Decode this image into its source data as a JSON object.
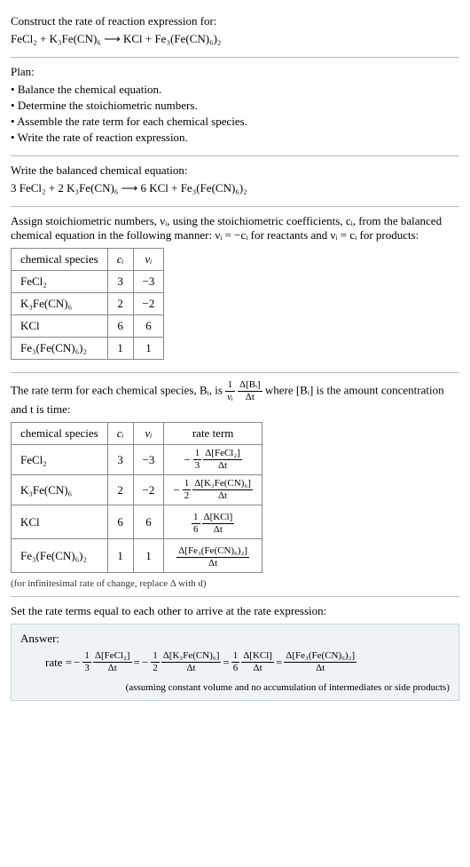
{
  "problem": {
    "prompt": "Construct the rate of reaction expression for:",
    "equation_unbalanced": "FeCl₂ + K₃Fe(CN)₆  ⟶  KCl + Fe₃(Fe(CN)₆)₂"
  },
  "plan": {
    "heading": "Plan:",
    "items": [
      "Balance the chemical equation.",
      "Determine the stoichiometric numbers.",
      "Assemble the rate term for each chemical species.",
      "Write the rate of reaction expression."
    ]
  },
  "balanced": {
    "heading": "Write the balanced chemical equation:",
    "equation": "3 FeCl₂ + 2 K₃Fe(CN)₆  ⟶  6 KCl + Fe₃(Fe(CN)₆)₂"
  },
  "stoich": {
    "intro": "Assign stoichiometric numbers, νᵢ, using the stoichiometric coefficients, cᵢ, from the balanced chemical equation in the following manner: νᵢ = −cᵢ for reactants and νᵢ = cᵢ for products:",
    "headers": [
      "chemical species",
      "cᵢ",
      "νᵢ"
    ],
    "rows": [
      {
        "species": "FeCl₂",
        "c": "3",
        "v": "−3"
      },
      {
        "species": "K₃Fe(CN)₆",
        "c": "2",
        "v": "−2"
      },
      {
        "species": "KCl",
        "c": "6",
        "v": "6"
      },
      {
        "species": "Fe₃(Fe(CN)₆)₂",
        "c": "1",
        "v": "1"
      }
    ]
  },
  "rate_terms": {
    "intro_a": "The rate term for each chemical species, Bᵢ, is ",
    "intro_b": " where [Bᵢ] is the amount concentration and t is time:",
    "frac1": {
      "num": "1",
      "den": "νᵢ"
    },
    "frac2": {
      "num": "Δ[Bᵢ]",
      "den": "Δt"
    },
    "headers": [
      "chemical species",
      "cᵢ",
      "νᵢ",
      "rate term"
    ],
    "rows": [
      {
        "species": "FeCl₂",
        "c": "3",
        "v": "−3",
        "sign": "−",
        "coef_num": "1",
        "coef_den": "3",
        "d_num": "Δ[FeCl₂]",
        "d_den": "Δt"
      },
      {
        "species": "K₃Fe(CN)₆",
        "c": "2",
        "v": "−2",
        "sign": "−",
        "coef_num": "1",
        "coef_den": "2",
        "d_num": "Δ[K₃Fe(CN)₆]",
        "d_den": "Δt"
      },
      {
        "species": "KCl",
        "c": "6",
        "v": "6",
        "sign": "",
        "coef_num": "1",
        "coef_den": "6",
        "d_num": "Δ[KCl]",
        "d_den": "Δt"
      },
      {
        "species": "Fe₃(Fe(CN)₆)₂",
        "c": "1",
        "v": "1",
        "sign": "",
        "coef_num": "",
        "coef_den": "",
        "d_num": "Δ[Fe₃(Fe(CN)₆)₂]",
        "d_den": "Δt"
      }
    ],
    "note": "(for infinitesimal rate of change, replace Δ with d)"
  },
  "final": {
    "heading": "Set the rate terms equal to each other to arrive at the rate expression:",
    "answer_label": "Answer:",
    "rate_word": "rate = ",
    "eq": " = ",
    "terms": [
      {
        "sign": "−",
        "coef_num": "1",
        "coef_den": "3",
        "d_num": "Δ[FeCl₂]",
        "d_den": "Δt"
      },
      {
        "sign": "−",
        "coef_num": "1",
        "coef_den": "2",
        "d_num": "Δ[K₃Fe(CN)₆]",
        "d_den": "Δt"
      },
      {
        "sign": "",
        "coef_num": "1",
        "coef_den": "6",
        "d_num": "Δ[KCl]",
        "d_den": "Δt"
      },
      {
        "sign": "",
        "coef_num": "",
        "coef_den": "",
        "d_num": "Δ[Fe₃(Fe(CN)₆)₂]",
        "d_den": "Δt"
      }
    ],
    "assumption": "(assuming constant volume and no accumulation of intermediates or side products)"
  }
}
